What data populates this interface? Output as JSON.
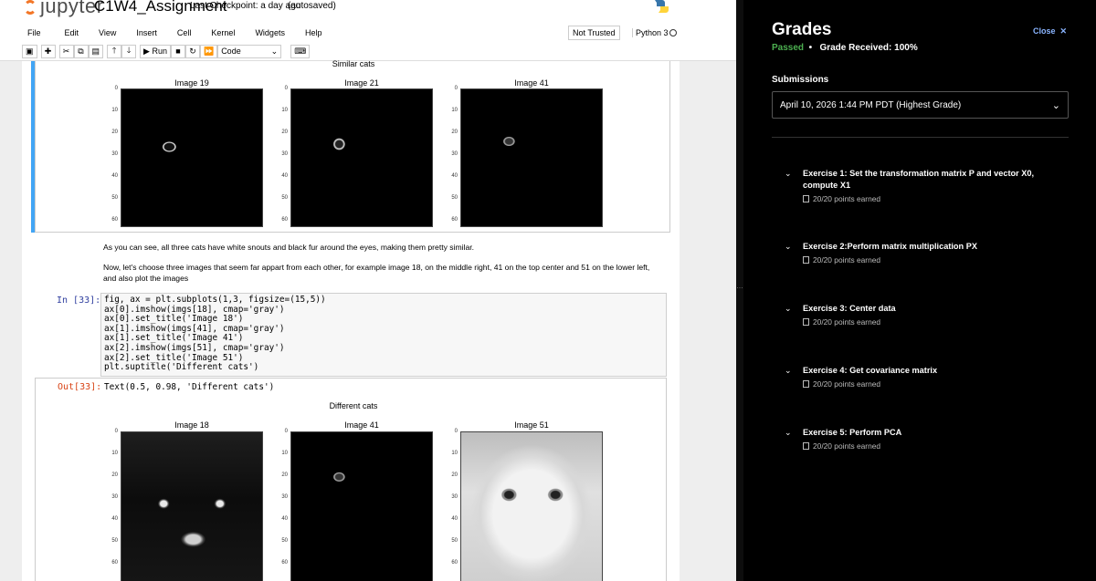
{
  "notebook": {
    "app_name": "jupyter",
    "title": "C1W4_Assignment",
    "checkpoint": "Last Checkpoint: a day ago",
    "autosave": "(autosaved)",
    "menu": [
      "File",
      "Edit",
      "View",
      "Insert",
      "Cell",
      "Kernel",
      "Widgets",
      "Help"
    ],
    "trust": "Not Trusted",
    "kernel": "Python 3",
    "toolbar": {
      "run_label": "Run",
      "cell_type": "Code"
    },
    "figure1": {
      "suptitle": "Similar cats",
      "subplots": [
        "Image 19",
        "Image 21",
        "Image 41"
      ]
    },
    "yticks": [
      "0",
      "10",
      "20",
      "30",
      "40",
      "50",
      "60"
    ],
    "markdown": {
      "p1": "As you can see, all three cats have white snouts and black fur around the eyes, making them pretty similar.",
      "p2": "Now, let's choose three images that seem far appart from each other, for example image 18, on the middle right, 41 on the top center and 51 on the lower left, and also plot the images"
    },
    "cell": {
      "in_prompt": "In [33]:",
      "code": "fig, ax = plt.subplots(1,3, figsize=(15,5))\nax[0].imshow(imgs[18], cmap='gray')\nax[0].set_title('Image 18')\nax[1].imshow(imgs[41], cmap='gray')\nax[1].set_title('Image 41')\nax[2].imshow(imgs[51], cmap='gray')\nax[2].set_title('Image 51')\nplt.suptitle('Different cats')",
      "out_prompt": "Out[33]:",
      "out_text": "Text(0.5, 0.98, 'Different cats')"
    },
    "figure2": {
      "suptitle": "Different cats",
      "subplots": [
        "Image 18",
        "Image 41",
        "Image 51"
      ]
    }
  },
  "grades": {
    "title": "Grades",
    "close": "Close",
    "status": "Passed",
    "received": "Grade Received: 100%",
    "submissions_heading": "Submissions",
    "submission_selected": "April 10, 2026 1:44 PM PDT (Highest Grade)",
    "exercises": [
      {
        "title": "Exercise 1: Set the transformation matrix P and vector X0, compute X1",
        "points": "20/20 points earned"
      },
      {
        "title": "Exercise 2:Perform matrix multiplication PX",
        "points": "20/20 points earned"
      },
      {
        "title": "Exercise 3: Center data",
        "points": "20/20 points earned"
      },
      {
        "title": "Exercise 4: Get covariance matrix",
        "points": "20/20 points earned"
      },
      {
        "title": "Exercise 5: Perform PCA",
        "points": "20/20 points earned"
      }
    ]
  }
}
